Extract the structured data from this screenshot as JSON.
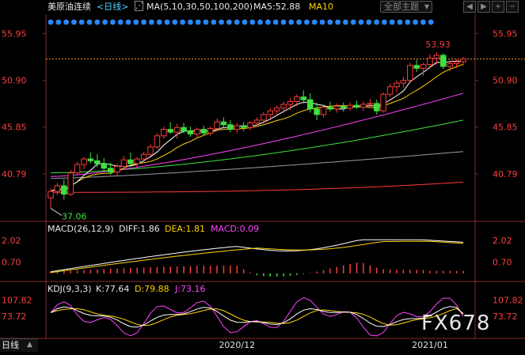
{
  "header": {
    "instrument": "美原油连续",
    "period": "<日线>",
    "ma_label": "MA(5,10,30,50,100,200)",
    "ma5_label": "MA5:52.88",
    "ma10_label": "MA10",
    "theme_select": "全部主题",
    "theme_arrow": "▼"
  },
  "tabs": {
    "period_tab": "日线"
  },
  "watermark": "FX678",
  "colors": {
    "background": "#000000",
    "up_candle": "#ff3b3b",
    "down_candle": "#3fe03f",
    "ma5": "#ffffff",
    "ma10": "#ffd400",
    "ma30": "#ff44ff",
    "ma50": "#3fe03f",
    "ma100": "#9a9aa8",
    "ma200": "#ff3b3b",
    "event_dots": "#2a88ff"
  },
  "chart_data": [
    {
      "type": "candlestick",
      "title": "美原油连续",
      "y_ticks": [
        "55.95",
        "50.90",
        "45.85",
        "40.79"
      ],
      "y_tick_values": [
        55.95,
        50.9,
        45.85,
        40.79
      ],
      "ylim": [
        36.0,
        56.5
      ],
      "x_ticks": [
        "2020/12",
        "2021/01"
      ],
      "x_tick_index": [
        28,
        57
      ],
      "annotations": {
        "high_label": "53.93",
        "low_label": "37.06",
        "high_value": 53.93,
        "low_value": 37.06
      },
      "ohlc": [
        [
          38.2,
          39.2,
          37.06,
          38.9
        ],
        [
          38.9,
          39.8,
          38.5,
          39.5
        ],
        [
          39.5,
          40.2,
          38.0,
          38.6
        ],
        [
          38.6,
          41.2,
          38.4,
          40.9
        ],
        [
          40.9,
          42.1,
          40.7,
          41.8
        ],
        [
          41.8,
          42.6,
          41.3,
          42.4
        ],
        [
          42.4,
          43.1,
          41.9,
          42.2
        ],
        [
          42.2,
          42.9,
          41.5,
          41.9
        ],
        [
          41.9,
          42.5,
          41.0,
          41.4
        ],
        [
          41.4,
          42.0,
          40.7,
          41.0
        ],
        [
          41.0,
          41.9,
          40.6,
          41.6
        ],
        [
          41.6,
          42.7,
          41.2,
          42.3
        ],
        [
          42.3,
          43.1,
          41.8,
          41.9
        ],
        [
          41.9,
          42.6,
          41.4,
          42.4
        ],
        [
          42.4,
          43.2,
          42.0,
          42.9
        ],
        [
          42.9,
          44.0,
          42.7,
          43.7
        ],
        [
          43.7,
          45.2,
          43.5,
          44.9
        ],
        [
          44.9,
          45.9,
          44.6,
          45.6
        ],
        [
          45.6,
          46.4,
          45.1,
          45.3
        ],
        [
          45.3,
          46.2,
          44.6,
          45.8
        ],
        [
          45.8,
          46.3,
          45.2,
          45.4
        ],
        [
          45.4,
          45.9,
          44.8,
          45.1
        ],
        [
          45.1,
          45.8,
          44.6,
          45.6
        ],
        [
          45.6,
          46.0,
          44.9,
          45.2
        ],
        [
          45.2,
          45.9,
          44.9,
          45.7
        ],
        [
          45.7,
          46.8,
          45.5,
          46.4
        ],
        [
          46.4,
          46.9,
          45.8,
          46.1
        ],
        [
          46.1,
          46.6,
          45.3,
          45.6
        ],
        [
          45.6,
          46.3,
          45.2,
          46.0
        ],
        [
          46.0,
          46.4,
          45.4,
          45.8
        ],
        [
          45.8,
          46.5,
          45.5,
          46.3
        ],
        [
          46.3,
          46.9,
          45.9,
          46.6
        ],
        [
          46.6,
          47.5,
          46.2,
          47.2
        ],
        [
          47.2,
          47.9,
          46.8,
          47.6
        ],
        [
          47.6,
          48.2,
          47.1,
          47.9
        ],
        [
          47.9,
          48.6,
          47.4,
          48.3
        ],
        [
          48.3,
          49.0,
          47.7,
          48.6
        ],
        [
          48.6,
          49.4,
          48.1,
          49.1
        ],
        [
          49.1,
          49.8,
          48.4,
          48.8
        ],
        [
          48.8,
          49.5,
          47.4,
          47.8
        ],
        [
          47.8,
          48.5,
          46.6,
          47.2
        ],
        [
          47.2,
          48.3,
          46.9,
          48.0
        ],
        [
          48.0,
          48.6,
          47.5,
          47.8
        ],
        [
          47.8,
          48.4,
          47.4,
          48.1
        ],
        [
          48.1,
          48.5,
          47.5,
          47.9
        ],
        [
          47.9,
          48.5,
          47.6,
          48.2
        ],
        [
          48.2,
          48.7,
          47.8,
          48.0
        ],
        [
          48.0,
          48.6,
          47.6,
          48.3
        ],
        [
          48.3,
          48.9,
          47.9,
          48.4
        ],
        [
          48.4,
          48.8,
          47.2,
          47.6
        ],
        [
          47.6,
          49.6,
          47.4,
          49.4
        ],
        [
          49.4,
          50.5,
          49.1,
          50.2
        ],
        [
          50.2,
          50.9,
          49.6,
          50.6
        ],
        [
          50.6,
          51.3,
          50.1,
          50.9
        ],
        [
          50.9,
          52.8,
          50.7,
          52.5
        ],
        [
          52.5,
          53.1,
          51.8,
          52.2
        ],
        [
          52.2,
          52.8,
          51.4,
          52.6
        ],
        [
          52.6,
          53.7,
          52.2,
          53.3
        ],
        [
          53.3,
          53.93,
          52.6,
          53.6
        ],
        [
          53.6,
          53.8,
          52.1,
          52.4
        ],
        [
          52.4,
          53.1,
          51.9,
          52.7
        ],
        [
          52.7,
          53.2,
          52.2,
          52.9
        ],
        [
          52.9,
          53.4,
          52.5,
          53.2
        ]
      ],
      "ma_series": [
        {
          "name": "MA5",
          "start": 38.6,
          "end": 52.9
        },
        {
          "name": "MA10",
          "start": 38.9,
          "end": 52.5
        },
        {
          "name": "MA30",
          "start": 40.5,
          "end": 49.5
        },
        {
          "name": "MA50",
          "start": 40.9,
          "end": 46.6
        },
        {
          "name": "MA100",
          "start": 40.3,
          "end": 43.2
        },
        {
          "name": "MA200",
          "start": 38.8,
          "end": 39.9
        }
      ]
    },
    {
      "type": "bar",
      "title": "MACD(26,12,9)",
      "params_label": "MACD(26,12,9)",
      "diff_label": "DIFF:1.86",
      "dea_label": "DEA:1.81",
      "macd_label": "MACD:0.09",
      "y_ticks": [
        "2.02",
        "0.70"
      ],
      "y_tick_values": [
        2.02,
        0.7
      ],
      "ylim": [
        -0.3,
        2.4
      ],
      "series": [
        {
          "name": "DIFF",
          "start": 0.1,
          "peak": 2.05,
          "end": 1.86
        },
        {
          "name": "DEA",
          "start": 0.05,
          "peak": 1.95,
          "end": 1.81
        },
        {
          "name": "MACD",
          "end": 0.09
        }
      ]
    },
    {
      "type": "line",
      "title": "KDJ(9,3,3)",
      "params_label": "KDJ(9,3,3)",
      "k_label": "K:77.64",
      "d_label": "D:79.88",
      "j_label": "J:73.16",
      "y_ticks": [
        "107.82",
        "73.72"
      ],
      "y_tick_values": [
        107.82,
        73.72
      ],
      "ylim": [
        30,
        120
      ],
      "series": [
        {
          "name": "K",
          "end": 77.64
        },
        {
          "name": "D",
          "end": 79.88
        },
        {
          "name": "J",
          "end": 73.16
        }
      ]
    }
  ]
}
